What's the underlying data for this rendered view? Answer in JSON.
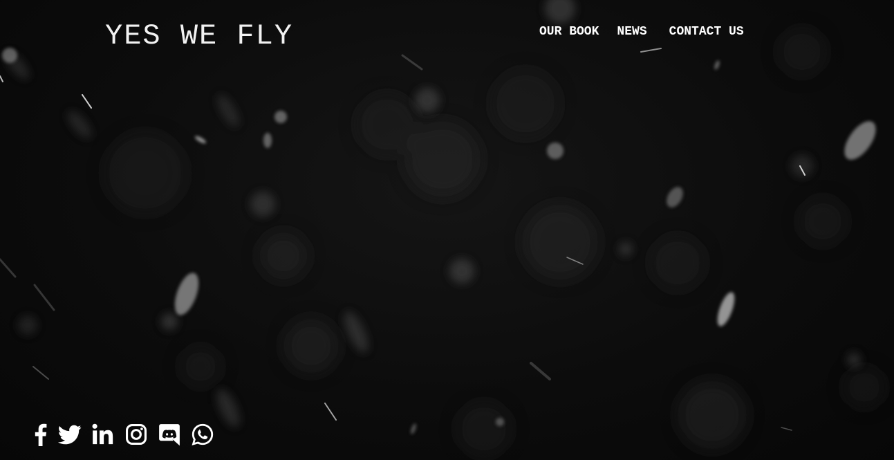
{
  "site": {
    "logo": "YES WE FLY"
  },
  "nav": {
    "items": [
      {
        "label": "OUR BOOK"
      },
      {
        "label": "NEWS"
      },
      {
        "label": "CONTACT US"
      }
    ]
  },
  "social": {
    "icons": [
      "facebook-icon",
      "twitter-icon",
      "linkedin-icon",
      "instagram-icon",
      "discord-icon",
      "whatsapp-icon"
    ]
  },
  "colors": {
    "background": "#0b0b0b",
    "text": "#ffffff"
  }
}
